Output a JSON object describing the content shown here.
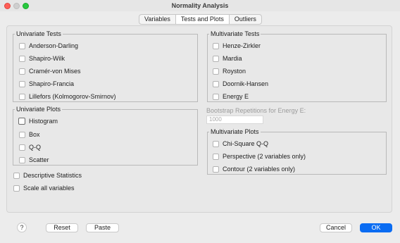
{
  "window": {
    "title": "Normality Analysis"
  },
  "tabs": [
    {
      "label": "Variables",
      "active": false
    },
    {
      "label": "Tests and Plots",
      "active": true
    },
    {
      "label": "Outliers",
      "active": false
    }
  ],
  "univariate_tests": {
    "title": "Univariate Tests",
    "items": [
      "Anderson-Darling",
      "Shapiro-Wilk",
      "Cramér-von Mises",
      "Shapiro-Francia",
      "Lillefors (Kolmogorov-Smirnov)"
    ]
  },
  "multivariate_tests": {
    "title": "Multivariate Tests",
    "items": [
      "Henze-Zirkler",
      "Mardia",
      "Royston",
      "Doornik-Hansen",
      "Energy E"
    ]
  },
  "univariate_plots": {
    "title": "Univariate Plots",
    "items": [
      "Histogram",
      "Box",
      "Q-Q",
      "Scatter"
    ]
  },
  "bootstrap": {
    "label": "Bootstrap Repetitions for Energy E:",
    "placeholder": "1000"
  },
  "multivariate_plots": {
    "title": "Multivariate Plots",
    "items": [
      "Chi-Square Q-Q",
      "Perspective (2 variables only)",
      "Contour (2 variables only)"
    ]
  },
  "options": [
    "Descriptive Statistics",
    "Scale all variables"
  ],
  "buttons": {
    "help": "?",
    "reset": "Reset",
    "paste": "Paste",
    "cancel": "Cancel",
    "ok": "OK"
  }
}
